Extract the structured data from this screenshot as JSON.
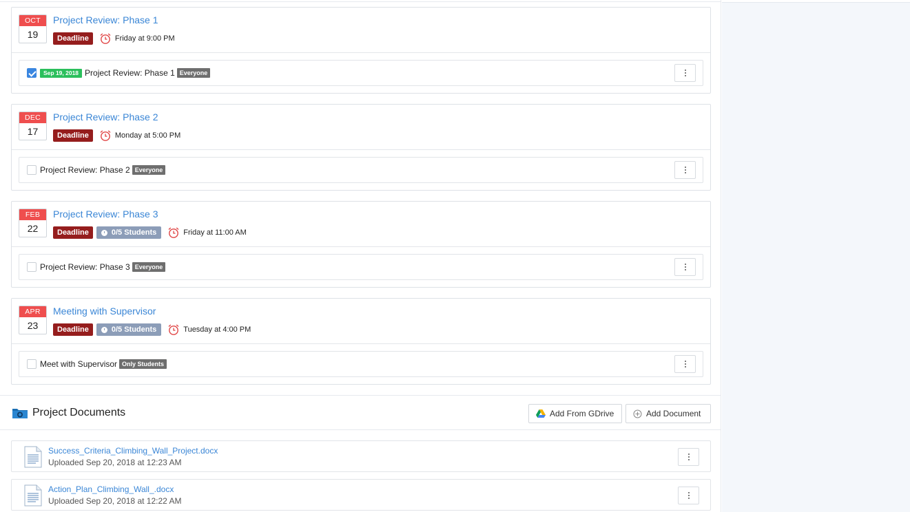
{
  "events": [
    {
      "month": "OCT",
      "day": "19",
      "title": "Project Review: Phase 1",
      "deadline_label": "Deadline",
      "students_label": "",
      "time": "Friday at 9:00 PM",
      "task": {
        "checked": true,
        "completed_badge": "Sep 19, 2018",
        "name": "Project Review: Phase 1",
        "audience": "Everyone"
      }
    },
    {
      "month": "DEC",
      "day": "17",
      "title": "Project Review: Phase 2",
      "deadline_label": "Deadline",
      "students_label": "",
      "time": "Monday at 5:00 PM",
      "task": {
        "checked": false,
        "completed_badge": "",
        "name": "Project Review: Phase 2",
        "audience": "Everyone"
      }
    },
    {
      "month": "FEB",
      "day": "22",
      "title": "Project Review: Phase 3",
      "deadline_label": "Deadline",
      "students_label": "0/5 Students",
      "time": "Friday at 11:00 AM",
      "task": {
        "checked": false,
        "completed_badge": "",
        "name": "Project Review: Phase 3",
        "audience": "Everyone"
      }
    },
    {
      "month": "APR",
      "day": "23",
      "title": "Meeting with Supervisor",
      "deadline_label": "Deadline",
      "students_label": "0/5 Students",
      "time": "Tuesday at 4:00 PM",
      "task": {
        "checked": false,
        "completed_badge": "",
        "name": "Meet with Supervisor",
        "audience": "Only Students"
      }
    }
  ],
  "documents_section": {
    "title": "Project Documents",
    "add_gdrive_label": "Add From GDrive",
    "add_document_label": "Add Document",
    "files": [
      {
        "name": "Success_Criteria_Climbing_Wall_Project.docx",
        "meta": "Uploaded Sep 20, 2018 at 12:23 AM"
      },
      {
        "name": "Action_Plan_Climbing_Wall_.docx",
        "meta": "Uploaded Sep 20, 2018 at 12:22 AM"
      }
    ]
  },
  "colors": {
    "calendar_header": "#ef4e4e",
    "deadline_badge": "#951d1d",
    "students_badge": "#8c9db8",
    "completed_badge": "#2bbf5c",
    "audience_badge": "#6e6e6e",
    "link": "#3a86d6",
    "alarm_icon": "#e04545"
  },
  "icons": {
    "alarm": "alarm-clock-icon",
    "kebab": "vertical-dots-icon",
    "folder": "folder-icon",
    "gdrive": "google-drive-icon",
    "add": "plus-circle-icon",
    "doc": "document-icon"
  }
}
